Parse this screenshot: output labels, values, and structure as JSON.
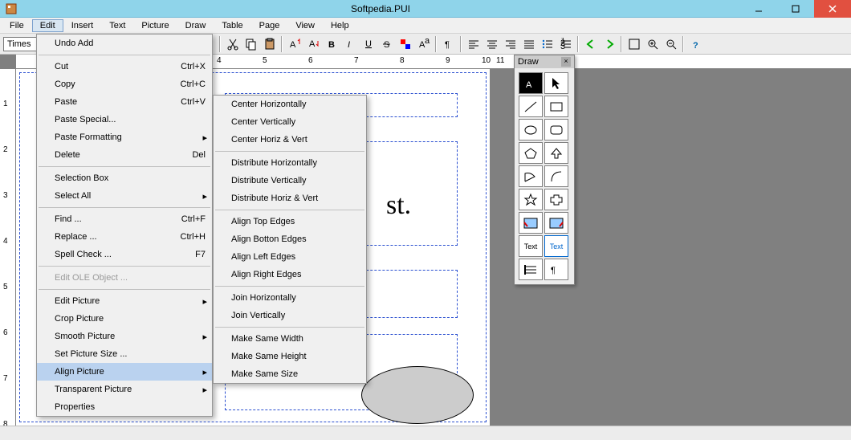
{
  "title": "Softpedia.PUI",
  "menubar": [
    "File",
    "Edit",
    "Insert",
    "Text",
    "Picture",
    "Draw",
    "Table",
    "Page",
    "View",
    "Help"
  ],
  "active_menu_index": 1,
  "font_box": "Times",
  "edit_menu": {
    "items": [
      {
        "label": "Undo Add",
        "type": "item"
      },
      {
        "type": "sep"
      },
      {
        "label": "Cut",
        "shortcut": "Ctrl+X",
        "type": "item"
      },
      {
        "label": "Copy",
        "shortcut": "Ctrl+C",
        "type": "item"
      },
      {
        "label": "Paste",
        "shortcut": "Ctrl+V",
        "type": "item"
      },
      {
        "label": "Paste Special...",
        "type": "item"
      },
      {
        "label": "Paste Formatting",
        "type": "sub"
      },
      {
        "label": "Delete",
        "shortcut": "Del",
        "type": "item"
      },
      {
        "type": "sep"
      },
      {
        "label": "Selection Box",
        "type": "item"
      },
      {
        "label": "Select All",
        "type": "sub"
      },
      {
        "type": "sep"
      },
      {
        "label": "Find ...",
        "shortcut": "Ctrl+F",
        "type": "item"
      },
      {
        "label": "Replace ...",
        "shortcut": "Ctrl+H",
        "type": "item"
      },
      {
        "label": "Spell Check ...",
        "shortcut": "F7",
        "type": "item"
      },
      {
        "type": "sep"
      },
      {
        "label": "Edit OLE Object ...",
        "type": "item",
        "disabled": true
      },
      {
        "type": "sep"
      },
      {
        "label": "Edit Picture",
        "type": "sub"
      },
      {
        "label": "Crop Picture",
        "type": "item"
      },
      {
        "label": "Smooth Picture",
        "type": "sub"
      },
      {
        "label": "Set Picture Size ...",
        "type": "item"
      },
      {
        "label": "Align Picture",
        "type": "sub",
        "hilite": true
      },
      {
        "label": "Transparent Picture",
        "type": "sub"
      },
      {
        "label": "Properties",
        "type": "item"
      }
    ]
  },
  "align_submenu": {
    "items": [
      {
        "label": "Center Horizontally",
        "type": "item"
      },
      {
        "label": "Center Vertically",
        "type": "item"
      },
      {
        "label": "Center Horiz & Vert",
        "type": "item"
      },
      {
        "type": "sep"
      },
      {
        "label": "Distribute Horizontally",
        "type": "item"
      },
      {
        "label": "Distribute Vertically",
        "type": "item"
      },
      {
        "label": "Distribute Horiz & Vert",
        "type": "item"
      },
      {
        "type": "sep"
      },
      {
        "label": "Align Top Edges",
        "type": "item"
      },
      {
        "label": "Align Botton Edges",
        "type": "item"
      },
      {
        "label": "Align Left Edges",
        "type": "item"
      },
      {
        "label": "Align Right Edges",
        "type": "item"
      },
      {
        "type": "sep"
      },
      {
        "label": "Join Horizontally",
        "type": "item"
      },
      {
        "label": "Join Vertically",
        "type": "item"
      },
      {
        "type": "sep"
      },
      {
        "label": "Make Same Width",
        "type": "item"
      },
      {
        "label": "Make Same Height",
        "type": "item"
      },
      {
        "label": "Make Same Size",
        "type": "item"
      }
    ]
  },
  "ruler_h_numbers": [
    "4",
    "5",
    "6",
    "7",
    "8",
    "9",
    "10",
    "11"
  ],
  "ruler_v_numbers": [
    "1",
    "2",
    "3",
    "4",
    "5",
    "6",
    "7",
    "8"
  ],
  "document_text": "st.",
  "draw_palette": {
    "title": "Draw",
    "cells": [
      "A",
      "arrow",
      "line",
      "rect",
      "ellipse",
      "rrect",
      "poly",
      "up",
      "curve",
      "arc",
      "star",
      "cross",
      "img1",
      "img2",
      "Text",
      "Text",
      "list",
      "para"
    ]
  },
  "toolbar_icons": [
    "cut",
    "copy",
    "paste",
    "font-grow",
    "font-shrink",
    "bold",
    "italic",
    "underline",
    "strike",
    "color",
    "super",
    "pilcrow",
    "align-left",
    "align-center",
    "align-right",
    "align-just",
    "bullets",
    "numbers",
    "arrow-left",
    "arrow-right",
    "fit",
    "zoom-in",
    "zoom-out",
    "help"
  ]
}
